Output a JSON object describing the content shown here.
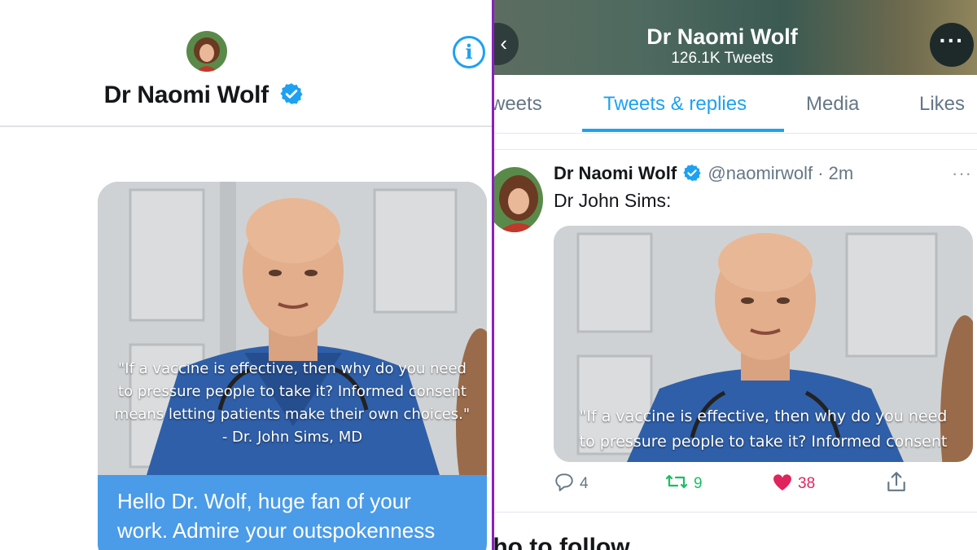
{
  "dm": {
    "contact_name": "Dr Naomi Wolf",
    "info_icon": "info-icon",
    "verified_icon": "verified-badge-icon",
    "photo_quote": {
      "line1": "\"If a vaccine is effective, then why do you need",
      "line2": "to pressure people to take it? Informed consent",
      "line3": "means letting patients make their own choices.\"",
      "attribution": "- Dr. John Sims, MD"
    },
    "message_line1": "Hello Dr. Wolf, huge fan of your",
    "message_line2": "work. Admire your outspokenness"
  },
  "profile": {
    "name": "Dr Naomi Wolf",
    "tweet_count": "126.1K Tweets",
    "back_icon": "back-arrow-icon",
    "more_icon": "more-options-icon",
    "more_label": "···"
  },
  "tabs": [
    {
      "label": "weets",
      "active": false
    },
    {
      "label": "Tweets & replies",
      "active": true
    },
    {
      "label": "Media",
      "active": false
    },
    {
      "label": "Likes",
      "active": false
    }
  ],
  "tweet": {
    "name": "Dr Naomi Wolf",
    "handle": "@naomirwolf",
    "separator": " · ",
    "time": "2m",
    "text": "Dr John Sims:",
    "menu_label": "···",
    "media_quote": {
      "line1": "\"If a vaccine is effective, then why do you need",
      "line2": "to pressure people to take it? Informed consent"
    },
    "reply_count": "4",
    "retweet_count": "9",
    "like_count": "38"
  },
  "footer": {
    "who_to_follow": "Who to follow"
  },
  "colors": {
    "twitter_blue": "#1da1f2",
    "dm_bubble": "#4a9be8",
    "retweet_green": "#17bf63",
    "like_red": "#e0245e",
    "divider_purple": "#8b1ec4"
  }
}
